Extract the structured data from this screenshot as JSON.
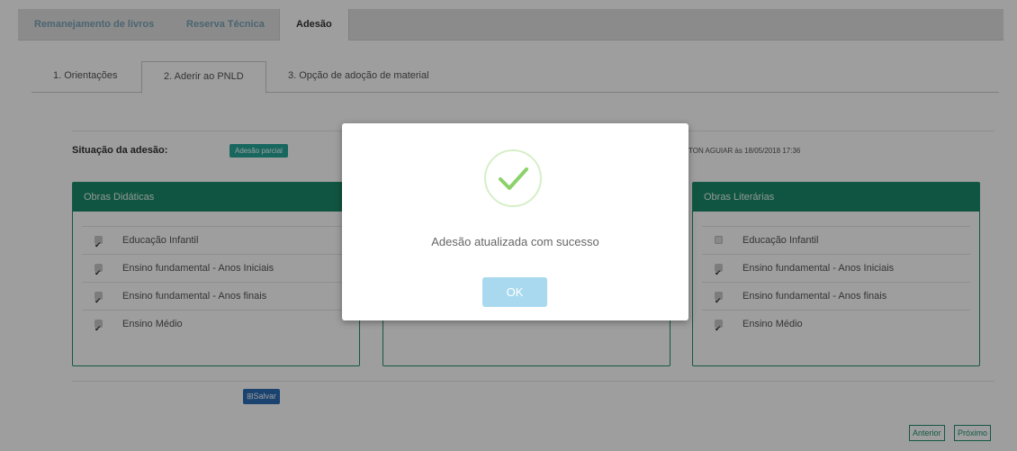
{
  "top_tabs": [
    "Remanejamento de livros",
    "Reserva Técnica",
    "Adesão"
  ],
  "sub_tabs": [
    "1. Orientações",
    "2. Aderir ao PNLD",
    "3. Opção de adoção de material"
  ],
  "situation": {
    "label": "Situação da adesão:",
    "badge": "Adesão parcial",
    "updated_text": "TON AGUIAR às 18/05/2018 17:36"
  },
  "panels": {
    "left": {
      "title": "Obras Didáticas",
      "items": [
        {
          "label": "Educação Infantil",
          "checked": true
        },
        {
          "label": "Ensino fundamental - Anos Iniciais",
          "checked": true
        },
        {
          "label": "Ensino fundamental - Anos finais",
          "checked": true
        },
        {
          "label": "Ensino Médio",
          "checked": true
        }
      ]
    },
    "right": {
      "title": "Obras Literárias",
      "items": [
        {
          "label": "Educação Infantil",
          "checked": false
        },
        {
          "label": "Ensino fundamental - Anos Iniciais",
          "checked": true
        },
        {
          "label": "Ensino fundamental - Anos finais",
          "checked": true
        },
        {
          "label": "Ensino Médio",
          "checked": true
        }
      ]
    }
  },
  "buttons": {
    "save": "Salvar",
    "previous": "Anterior",
    "next": "Próximo"
  },
  "modal": {
    "message": "Adesão atualizada com sucesso",
    "ok": "OK"
  },
  "colors": {
    "teal": "#1a8a6a",
    "badge": "#26a69a",
    "save_blue": "#2a6db5",
    "ok_button": "#a9d9ef",
    "check_green": "#8cd16a"
  }
}
